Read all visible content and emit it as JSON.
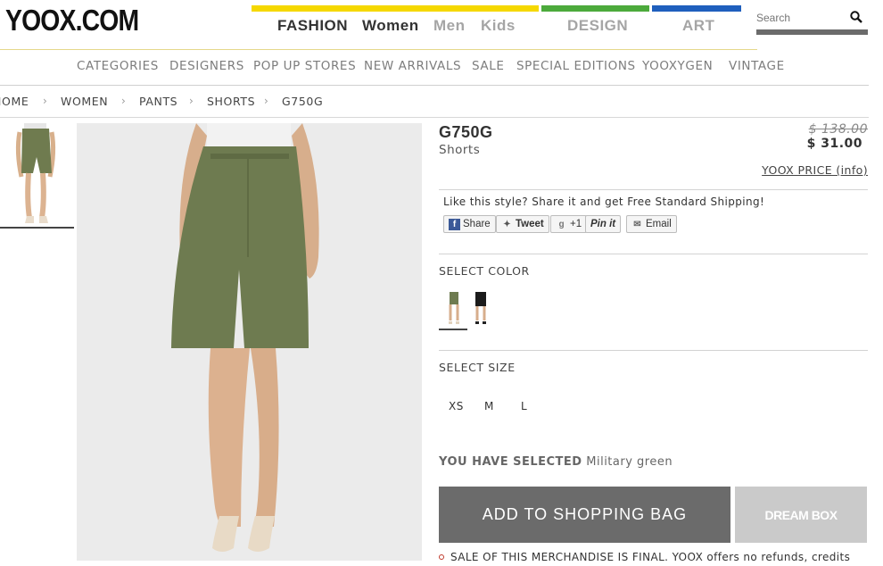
{
  "header": {
    "logo": "YOOX.COM",
    "nav": [
      {
        "label": "FASHION",
        "color": "#333333"
      },
      {
        "label": "Women",
        "color": "#333333"
      },
      {
        "label": "Men",
        "color": "#a5a5a5"
      },
      {
        "label": "Kids",
        "color": "#a5a5a5"
      },
      {
        "label": "DESIGN",
        "color": "#a5a5a5"
      },
      {
        "label": "ART",
        "color": "#a5a5a5"
      }
    ],
    "bar_colors": {
      "fashion": "#f5d800",
      "design": "#4caa3c",
      "art": "#1f5fbd"
    },
    "search": {
      "placeholder": "Search",
      "icon": "search-icon"
    }
  },
  "categories": [
    "CATEGORIES",
    "DESIGNERS",
    "POP UP STORES",
    "NEW ARRIVALS",
    "SALE",
    "SPECIAL EDITIONS",
    "YOOXYGEN",
    "VINTAGE"
  ],
  "breadcrumb": [
    "HOME",
    "WOMEN",
    "PANTS",
    "SHORTS",
    "G750G"
  ],
  "product": {
    "title": "G750G",
    "subtitle": "Shorts",
    "old_price": "$ 138.00",
    "price": "$ 31.00",
    "yoox_price_link": "YOOX PRICE (info)"
  },
  "share": {
    "text": "Like this style? Share it and get Free Standard Shipping!",
    "buttons": [
      {
        "label": "Share",
        "icon": "facebook-icon"
      },
      {
        "label": "Tweet",
        "icon": "twitter-icon"
      },
      {
        "label": "+1",
        "icon": "google-plus-icon"
      },
      {
        "label": "Pin it",
        "icon": "pinterest-icon"
      },
      {
        "label": "Email",
        "icon": "email-icon"
      }
    ]
  },
  "color_section": {
    "label": "SELECT COLOR",
    "swatches": [
      {
        "name": "Military green",
        "color": "#6b7a4f"
      },
      {
        "name": "Black",
        "color": "#1b1b1b"
      }
    ]
  },
  "size_section": {
    "label": "SELECT SIZE",
    "sizes": [
      "XS",
      "M",
      "L"
    ]
  },
  "selection": {
    "label": "YOU HAVE SELECTED",
    "value": "Military green"
  },
  "actions": {
    "add_to_bag": "ADD TO SHOPPING BAG",
    "dream_box": "DREAM BOX"
  },
  "sale_note": "SALE OF THIS MERCHANDISE IS FINAL. YOOX offers no refunds, credits"
}
